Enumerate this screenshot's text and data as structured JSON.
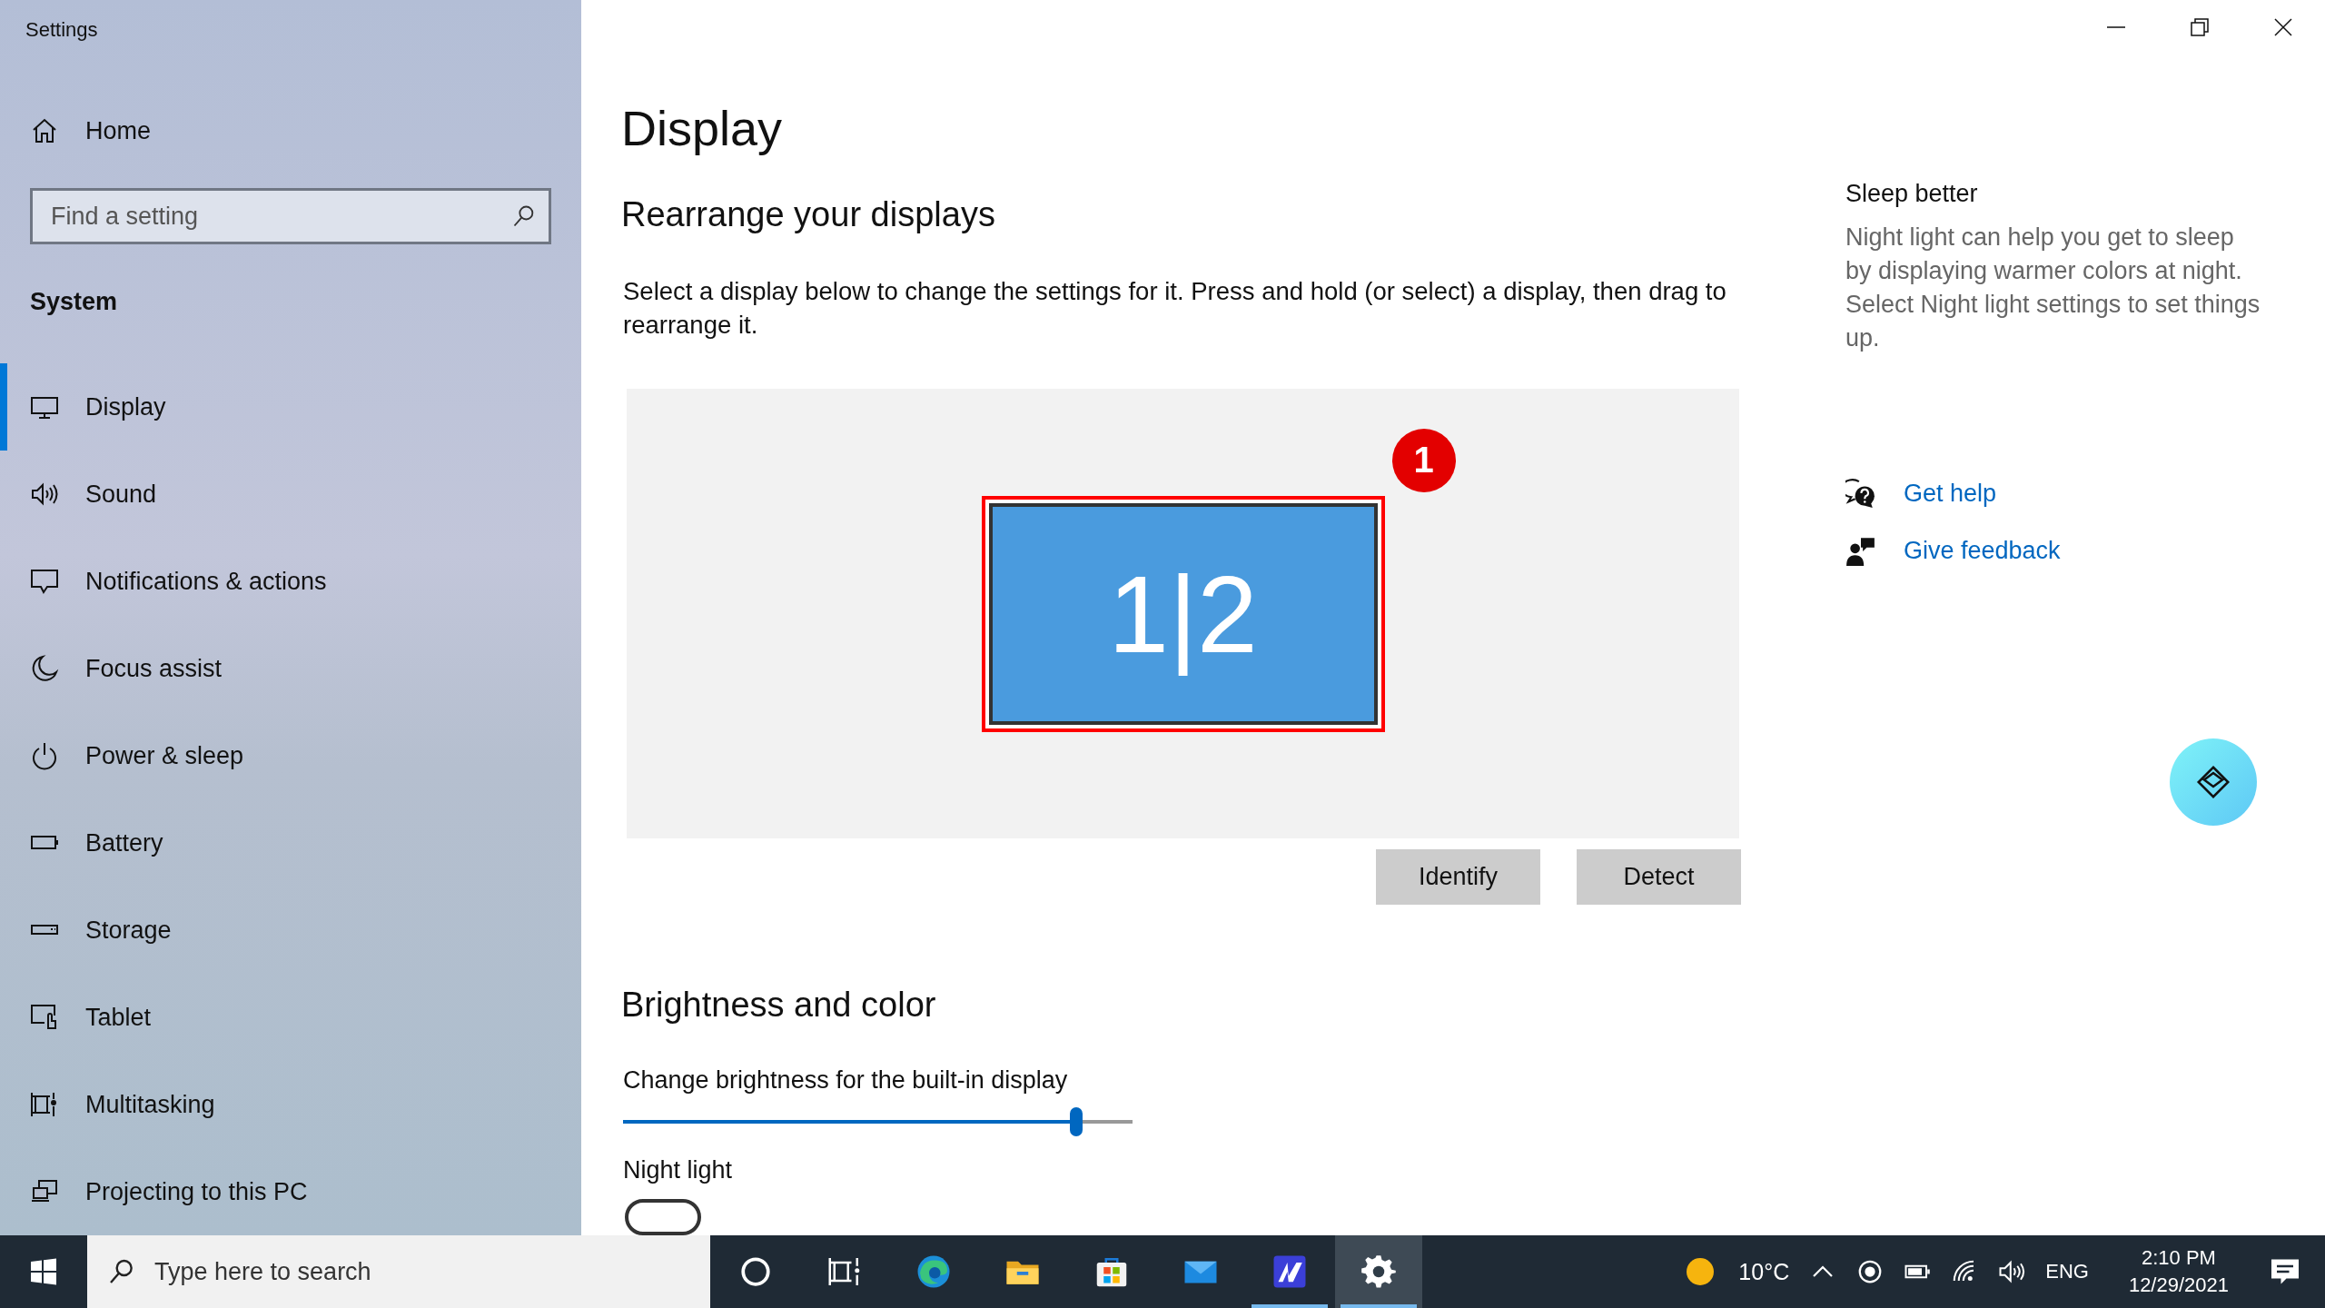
{
  "window": {
    "title": "Settings"
  },
  "sidebar": {
    "home": {
      "label": "Home"
    },
    "search": {
      "placeholder": "Find a setting"
    },
    "section": "System",
    "items": [
      {
        "label": "Display",
        "kind": "display",
        "selected": true
      },
      {
        "label": "Sound",
        "kind": "sound",
        "selected": false
      },
      {
        "label": "Notifications & actions",
        "kind": "notifications",
        "selected": false
      },
      {
        "label": "Focus assist",
        "kind": "focus",
        "selected": false
      },
      {
        "label": "Power & sleep",
        "kind": "power",
        "selected": false
      },
      {
        "label": "Battery",
        "kind": "battery",
        "selected": false
      },
      {
        "label": "Storage",
        "kind": "storage",
        "selected": false
      },
      {
        "label": "Tablet",
        "kind": "tablet",
        "selected": false
      },
      {
        "label": "Multitasking",
        "kind": "multitasking",
        "selected": false
      },
      {
        "label": "Projecting to this PC",
        "kind": "projecting",
        "selected": false
      }
    ]
  },
  "main": {
    "title": "Display",
    "rearrange": {
      "heading": "Rearrange your displays",
      "description": "Select a display below to change the settings for it. Press and hold (or select) a display, then drag to rearrange it.",
      "monitor": {
        "label": "1|2",
        "selected": true
      },
      "badge": "1",
      "buttons": [
        "Identify",
        "Detect"
      ]
    },
    "brightness": {
      "heading": "Brightness and color",
      "slider_label": "Change brightness for the built-in display",
      "level": 0.89,
      "night_light": {
        "label": "Night light",
        "on": false
      }
    }
  },
  "aside": {
    "heading": "Sleep better",
    "text": "Night light can help you get to sleep by displaying warmer colors at night. Select Night light settings to set things up.",
    "links": [
      {
        "label": "Get help",
        "kind": "help"
      },
      {
        "label": "Give feedback",
        "kind": "feedback"
      }
    ]
  },
  "taskbar": {
    "search": {
      "placeholder": "Type here to search"
    },
    "buttons": [
      {
        "kind": "cortana"
      },
      {
        "kind": "task-view"
      }
    ],
    "apps": [
      {
        "kind": "edge",
        "running": false,
        "selected": false
      },
      {
        "kind": "explorer",
        "running": false,
        "selected": false
      },
      {
        "kind": "store",
        "running": false,
        "selected": false
      },
      {
        "kind": "mail",
        "running": false,
        "selected": false
      },
      {
        "kind": "editor",
        "running": true,
        "selected": false
      },
      {
        "kind": "settings",
        "running": true,
        "selected": true
      }
    ],
    "weather": "10°C",
    "language": "ENG",
    "time": "2:10 PM",
    "date": "12/29/2021"
  }
}
